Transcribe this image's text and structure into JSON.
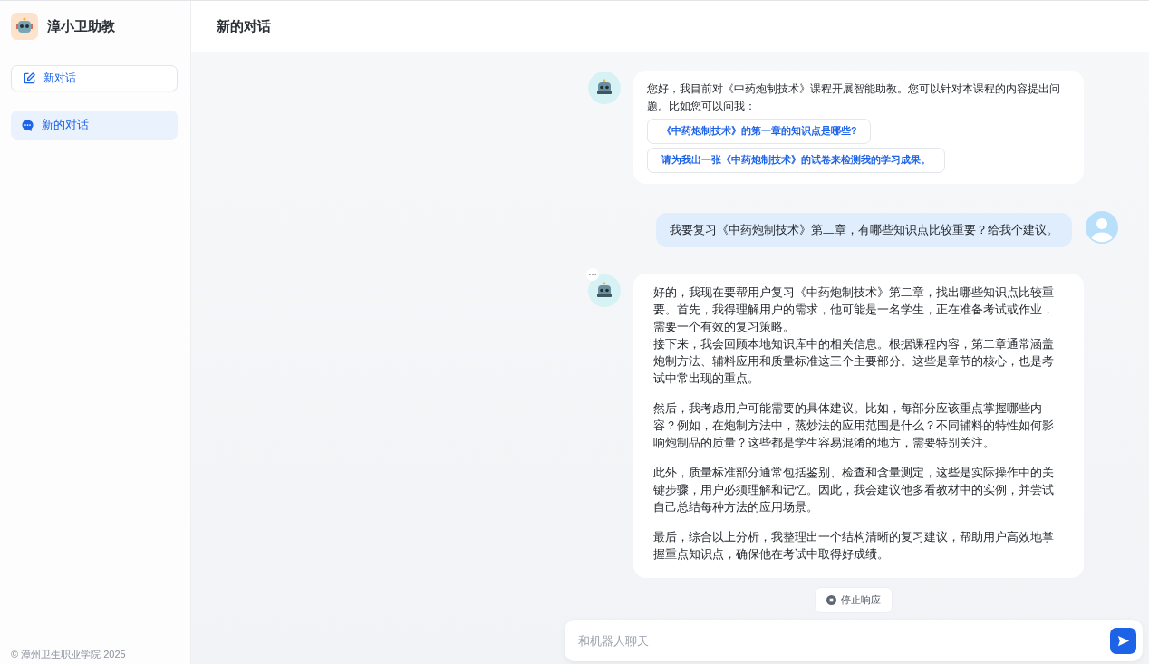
{
  "sidebar": {
    "app_name": "漳小卫助教",
    "new_chat_button": "新对话",
    "conversations": [
      {
        "title": "新的对话",
        "selected": true
      }
    ],
    "footer": "© 漳州卫生职业学院 2025"
  },
  "header": {
    "title": "新的对话"
  },
  "messages": [
    {
      "kind": "bot",
      "text": "您好，我目前对《中药炮制技术》课程开展智能助教。您可以针对本课程的内容提出问题。比如您可以问我：",
      "suggestions": [
        "《中药炮制技术》的第一章的知识点是哪些?",
        "请为我出一张《中药炮制技术》的试卷来检测我的学习成果。"
      ]
    },
    {
      "kind": "user",
      "text": "我要复习《中药炮制技术》第二章，有哪些知识点比较重要？给我个建议。"
    },
    {
      "kind": "bot",
      "typing": true,
      "paragraphs": [
        [
          "好的，我现在要帮用户复习《中药炮制技术》第二章，找出哪些知识点比较重要。首先，我得理解用户的需求，他可能是一名学生，正在准备考试或作业，需要一个有效的复习策略。",
          "接下来，我会回顾本地知识库中的相关信息。根据课程内容，第二章通常涵盖炮制方法、辅料应用和质量标准这三个主要部分。这些是章节的核心，也是考试中常出现的重点。"
        ],
        [
          "然后，我考虑用户可能需要的具体建议。比如，每部分应该重点掌握哪些内容？例如，在炮制方法中，蒸炒法的应用范围是什么？不同辅料的特性如何影响炮制品的质量？这些都是学生容易混淆的地方，需要特别关注。"
        ],
        [
          "此外，质量标准部分通常包括鉴别、检查和含量测定，这些是实际操作中的关键步骤，用户必须理解和记忆。因此，我会建议他多看教材中的实例，并尝试自己总结每种方法的应用场景。"
        ],
        [
          "最后，综合以上分析，我整理出一个结构清晰的复习建议，帮助用户高效地掌握重点知识点，确保他在考试中取得好成绩。"
        ]
      ]
    }
  ],
  "stop_button": "停止响应",
  "input": {
    "placeholder": "和机器人聊天"
  }
}
